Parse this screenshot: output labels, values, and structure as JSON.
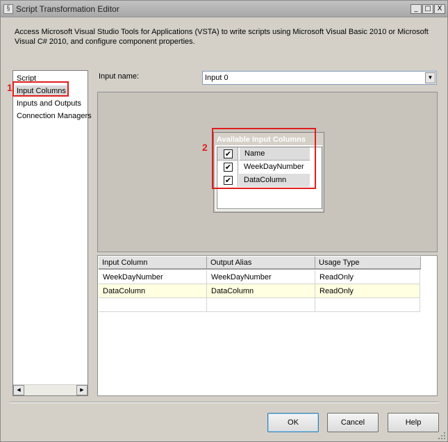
{
  "window": {
    "title": "Script Transformation Editor",
    "icon": "script-icon",
    "controls": {
      "minimize": "_",
      "maximize": "□",
      "close": "X"
    }
  },
  "description": "Access Microsoft Visual Studio Tools for Applications (VSTA) to write scripts using Microsoft Visual Basic 2010 or Microsoft Visual C# 2010, and configure component properties.",
  "nav": {
    "items": [
      {
        "label": "Script"
      },
      {
        "label": "Input Columns",
        "selected": true
      },
      {
        "label": "Inputs and Outputs"
      },
      {
        "label": "Connection Managers"
      }
    ],
    "scroll_left": "◀",
    "scroll_right": "▶"
  },
  "annotations": {
    "marker1": "1",
    "marker2": "2",
    "color": "#e01d1d"
  },
  "input": {
    "label": "Input name:",
    "value": "Input 0",
    "dropdown_glyph": "▼"
  },
  "available_columns": {
    "title": "Available Input Columns",
    "header_name": "Name",
    "header_checked": true,
    "rows": [
      {
        "name": "WeekDayNumber",
        "checked": true
      },
      {
        "name": "DataColumn",
        "checked": true
      }
    ]
  },
  "mapping_grid": {
    "headers": [
      "Input Column",
      "Output Alias",
      "Usage Type"
    ],
    "rows": [
      {
        "input_column": "WeekDayNumber",
        "output_alias": "WeekDayNumber",
        "usage_type": "ReadOnly"
      },
      {
        "input_column": "DataColumn",
        "output_alias": "DataColumn",
        "usage_type": "ReadOnly"
      }
    ]
  },
  "buttons": {
    "ok": "OK",
    "cancel": "Cancel",
    "help": "Help"
  },
  "check_glyph": "✔"
}
